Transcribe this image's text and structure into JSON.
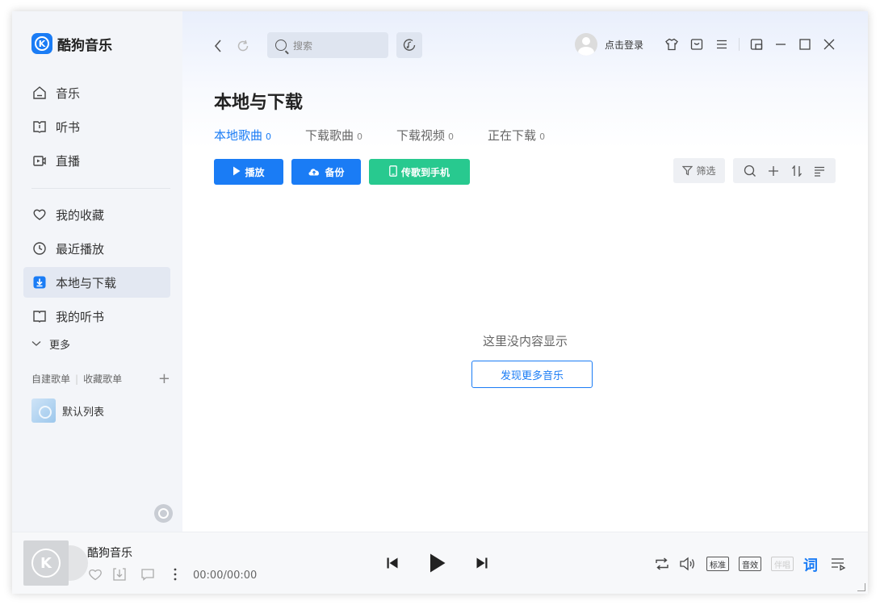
{
  "app": {
    "name": "酷狗音乐"
  },
  "sidebar": {
    "main_items": [
      {
        "label": "音乐",
        "icon": "home-icon"
      },
      {
        "label": "听书",
        "icon": "book-open-icon"
      },
      {
        "label": "直播",
        "icon": "live-video-icon"
      }
    ],
    "library_items": [
      {
        "label": "我的收藏",
        "icon": "heart-icon"
      },
      {
        "label": "最近播放",
        "icon": "clock-icon"
      },
      {
        "label": "本地与下载",
        "icon": "download-icon",
        "active": true
      },
      {
        "label": "我的听书",
        "icon": "book-icon"
      }
    ],
    "more_label": "更多",
    "playlist_tabs": {
      "created": "自建歌单",
      "collected": "收藏歌单"
    },
    "playlists": [
      {
        "label": "默认列表"
      }
    ]
  },
  "topbar": {
    "search_placeholder": "搜索",
    "login_label": "点击登录"
  },
  "page": {
    "title": "本地与下载",
    "tabs": [
      {
        "label": "本地歌曲",
        "count": "0",
        "active": true
      },
      {
        "label": "下载歌曲",
        "count": "0"
      },
      {
        "label": "下载视频",
        "count": "0"
      },
      {
        "label": "正在下载",
        "count": "0"
      }
    ],
    "actions": {
      "play": "播放",
      "backup": "备份",
      "to_phone": "传歌到手机"
    },
    "filter_label": "筛选",
    "empty_text": "这里没内容显示",
    "discover_label": "发现更多音乐"
  },
  "player": {
    "song_title": "酷狗音乐",
    "time": "00:00/00:00",
    "quality_badges": [
      "标准",
      "音效",
      "伴唱"
    ],
    "lyric_label": "词"
  },
  "colors": {
    "accent": "#1a7cf5",
    "green": "#28c98f"
  }
}
